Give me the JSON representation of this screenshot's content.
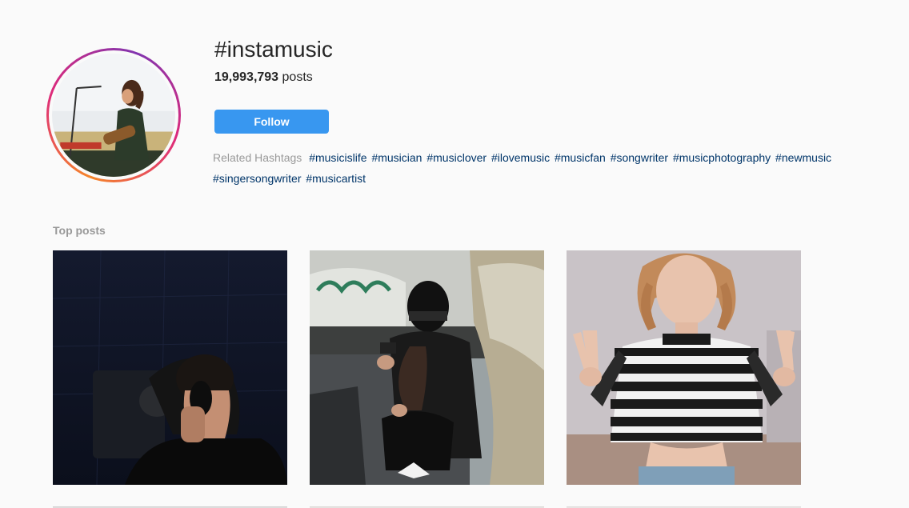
{
  "header": {
    "hashtag": "#instamusic",
    "post_count": "19,993,793",
    "post_suffix": " posts",
    "follow_label": "Follow",
    "related_label": "Related Hashtags",
    "related": [
      "#musicislife",
      "#musician",
      "#musiclover",
      "#ilovemusic",
      "#musicfan",
      "#songwriter",
      "#musicphotography",
      "#newmusic",
      "#singersongwriter",
      "#musicartist"
    ]
  },
  "top_posts": {
    "label": "Top posts"
  },
  "colors": {
    "follow_button": "#3897f0",
    "hashtag_link": "#003569",
    "muted_text": "#999999",
    "background": "#fafafa"
  }
}
